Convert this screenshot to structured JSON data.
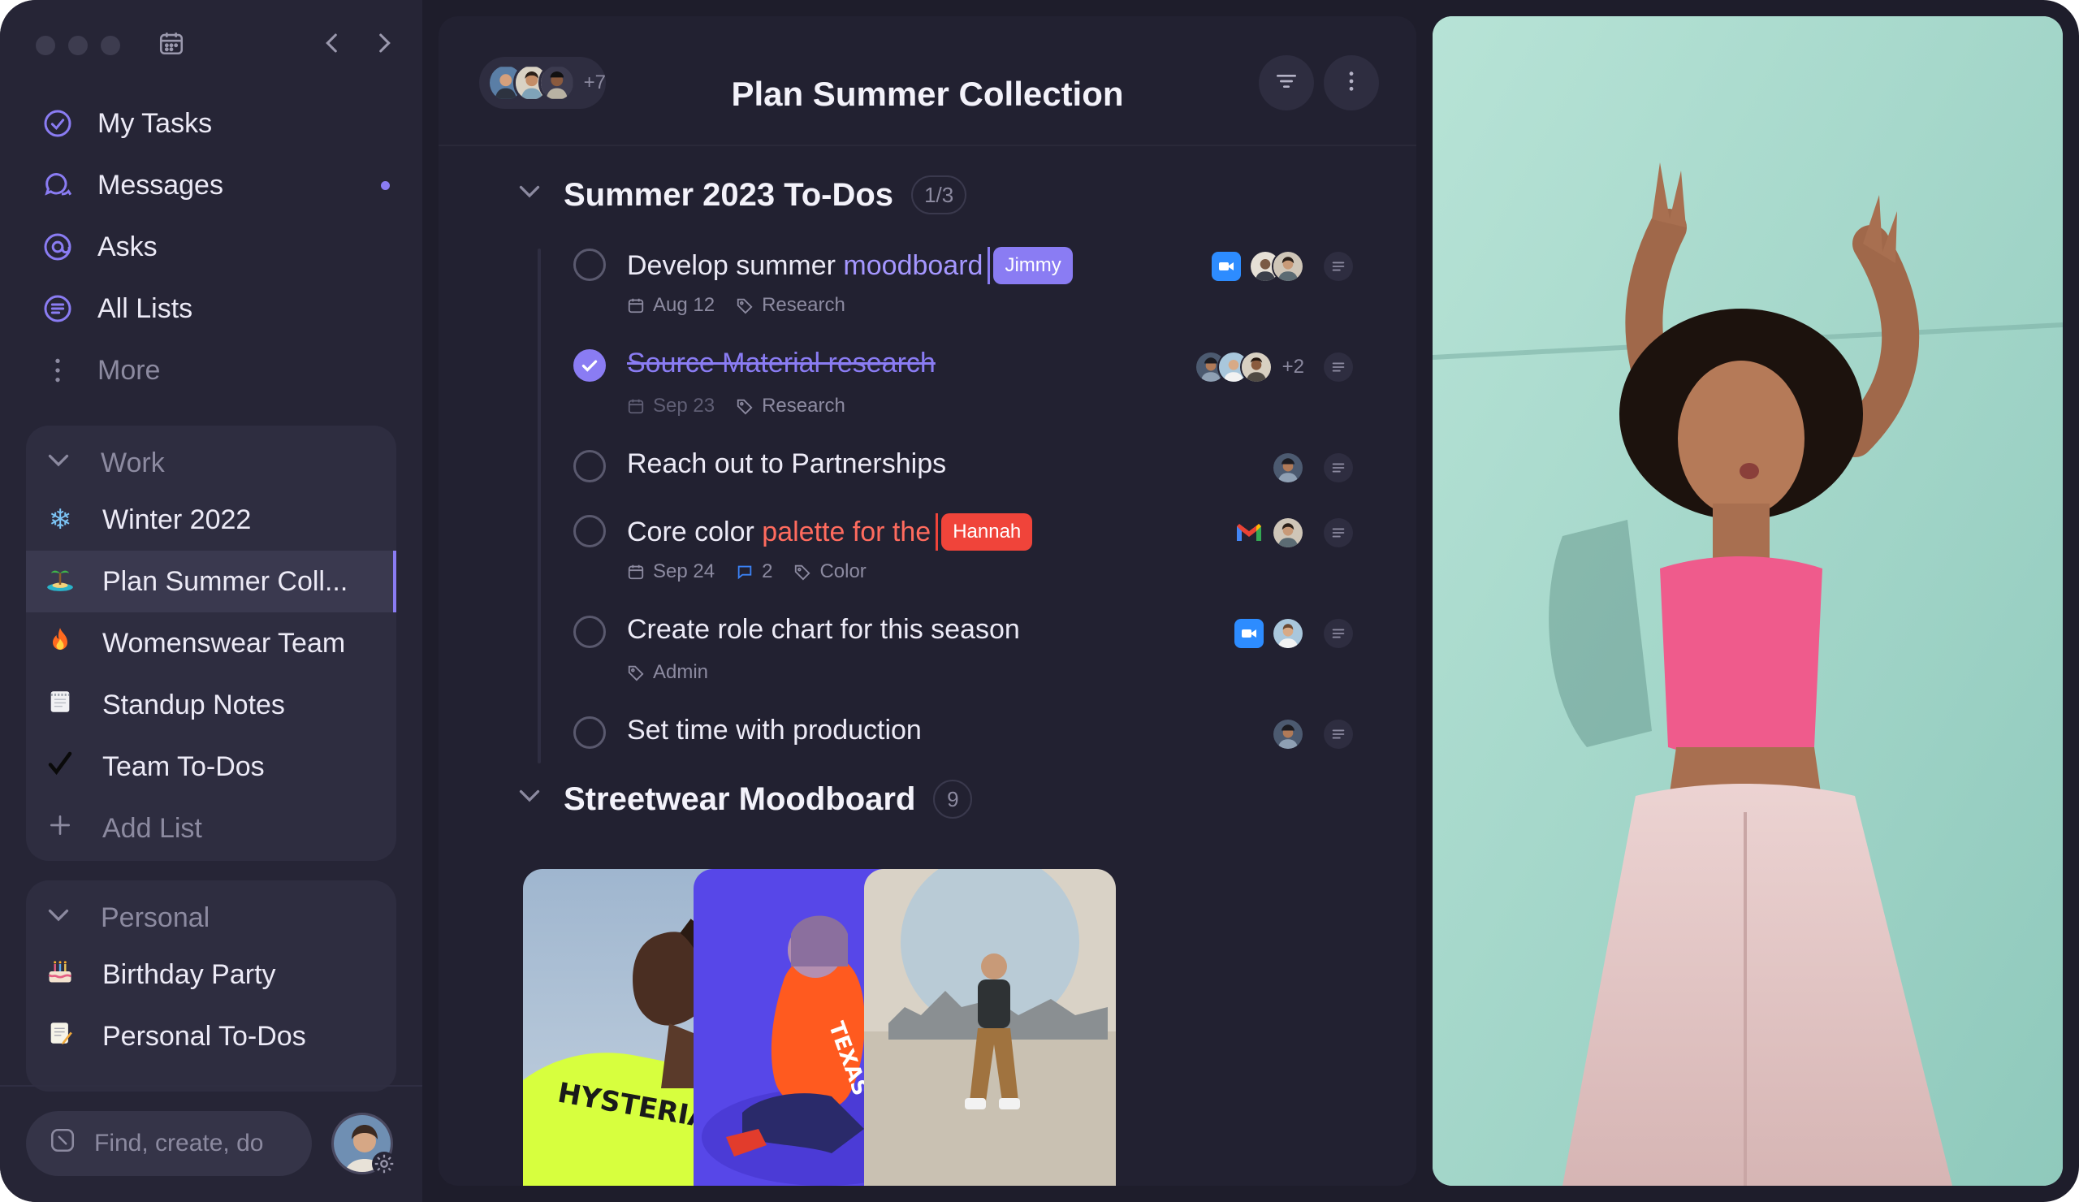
{
  "sidebar": {
    "nav": [
      {
        "label": "My Tasks",
        "icon": "check-circle-icon"
      },
      {
        "label": "Messages",
        "icon": "chat-bubbles-icon",
        "unread": true
      },
      {
        "label": "Asks",
        "icon": "at-sign-icon"
      },
      {
        "label": "All Lists",
        "icon": "list-icon"
      },
      {
        "label": "More",
        "icon": "vertical-dots-icon"
      }
    ],
    "work": {
      "label": "Work",
      "items": [
        {
          "label": "Winter 2022",
          "emoji": "❄"
        },
        {
          "label": "Plan Summer Coll...",
          "emoji": "🏝",
          "active": true
        },
        {
          "label": "Womenswear Team",
          "emoji": "🔥"
        },
        {
          "label": "Standup Notes",
          "emoji": "🗒"
        },
        {
          "label": "Team To-Dos",
          "emoji": "✔"
        }
      ],
      "add_label": "Add List"
    },
    "personal": {
      "label": "Personal",
      "items": [
        {
          "label": "Birthday Party",
          "emoji": "🎂"
        },
        {
          "label": "Personal To-Dos",
          "emoji": "📝"
        }
      ]
    },
    "search_placeholder": "Find, create, do"
  },
  "header": {
    "title": "Plan Summer Collection",
    "members_extra": "+7"
  },
  "sections": [
    {
      "title": "Summer 2023 To-Dos",
      "count": "1/3",
      "tasks": [
        {
          "title_plain": "Develop summer ",
          "title_highlight": "moodboard",
          "cursor_user": "Jimmy",
          "date": "Aug 12",
          "tag": "Research",
          "done": false
        },
        {
          "title": "Source Material research",
          "date": "Sep 23",
          "tag": "Research",
          "extra_assignees": "+2",
          "done": true
        },
        {
          "title": "Reach out to Partnerships",
          "done": false
        },
        {
          "title_plain": "Core color ",
          "title_highlight": "palette for the",
          "cursor_user": "Hannah",
          "date": "Sep 24",
          "comments": "2",
          "tag": "Color",
          "done": false
        },
        {
          "title": "Create role chart for this season",
          "tag": "Admin",
          "done": false
        },
        {
          "title": "Set time with production",
          "done": false
        }
      ]
    },
    {
      "title": "Streetwear Moodboard",
      "count": "9"
    }
  ],
  "colors": {
    "accent": "#8a7cf3",
    "jimmy": "#8a7cf3",
    "hannah": "#f0443a",
    "zoom": "#2d8cff"
  }
}
